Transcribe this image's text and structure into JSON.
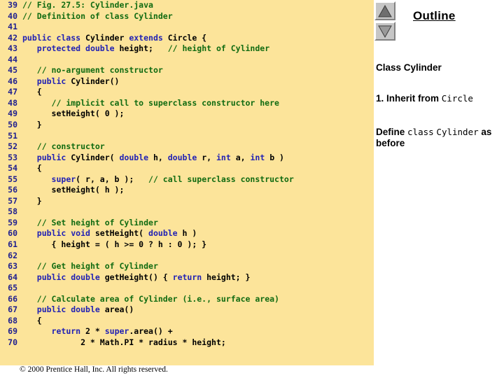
{
  "colors": {
    "code_background": "#fce49a",
    "keyword": "#2222b4",
    "comment": "#116b11",
    "plain_code": "#000000",
    "line_number": "#1f1f8f",
    "page_background": "#ffffff",
    "button_face": "#c6c6c6"
  },
  "code": {
    "lines": [
      {
        "no": "39",
        "segments": [
          {
            "t": "",
            "c": "plain"
          },
          {
            "t": "// Fig. 27.5: Cylinder.java",
            "c": "cmt"
          }
        ]
      },
      {
        "no": "40",
        "segments": [
          {
            "t": "// Definition of class Cylinder",
            "c": "cmt"
          }
        ]
      },
      {
        "no": "41",
        "segments": [
          {
            "t": "",
            "c": "plain"
          }
        ]
      },
      {
        "no": "42",
        "segments": [
          {
            "t": "public class ",
            "c": "kw"
          },
          {
            "t": "Cylinder ",
            "c": "plain"
          },
          {
            "t": "extends ",
            "c": "kw"
          },
          {
            "t": "Circle {",
            "c": "plain"
          }
        ]
      },
      {
        "no": "43",
        "segments": [
          {
            "t": "   ",
            "c": "plain"
          },
          {
            "t": "protected double ",
            "c": "kw"
          },
          {
            "t": "height;   ",
            "c": "plain"
          },
          {
            "t": "// height of Cylinder",
            "c": "cmt"
          }
        ]
      },
      {
        "no": "44",
        "segments": [
          {
            "t": "",
            "c": "plain"
          }
        ]
      },
      {
        "no": "45",
        "segments": [
          {
            "t": "   ",
            "c": "plain"
          },
          {
            "t": "// no-argument constructor",
            "c": "cmt"
          }
        ]
      },
      {
        "no": "46",
        "segments": [
          {
            "t": "   ",
            "c": "plain"
          },
          {
            "t": "public ",
            "c": "kw"
          },
          {
            "t": "Cylinder()",
            "c": "plain"
          }
        ]
      },
      {
        "no": "47",
        "segments": [
          {
            "t": "   {",
            "c": "plain"
          }
        ]
      },
      {
        "no": "48",
        "segments": [
          {
            "t": "      ",
            "c": "plain"
          },
          {
            "t": "// implicit call to superclass constructor here",
            "c": "cmt"
          }
        ]
      },
      {
        "no": "49",
        "segments": [
          {
            "t": "      setHeight( 0 );",
            "c": "plain"
          }
        ]
      },
      {
        "no": "50",
        "segments": [
          {
            "t": "   }",
            "c": "plain"
          }
        ]
      },
      {
        "no": "51",
        "segments": [
          {
            "t": "",
            "c": "plain"
          }
        ]
      },
      {
        "no": "52",
        "segments": [
          {
            "t": "   ",
            "c": "plain"
          },
          {
            "t": "// constructor",
            "c": "cmt"
          }
        ]
      },
      {
        "no": "53",
        "segments": [
          {
            "t": "   ",
            "c": "plain"
          },
          {
            "t": "public ",
            "c": "kw"
          },
          {
            "t": "Cylinder( ",
            "c": "plain"
          },
          {
            "t": "double ",
            "c": "kw"
          },
          {
            "t": "h, ",
            "c": "plain"
          },
          {
            "t": "double ",
            "c": "kw"
          },
          {
            "t": "r, ",
            "c": "plain"
          },
          {
            "t": "int ",
            "c": "kw"
          },
          {
            "t": "a, ",
            "c": "plain"
          },
          {
            "t": "int ",
            "c": "kw"
          },
          {
            "t": "b )",
            "c": "plain"
          }
        ]
      },
      {
        "no": "54",
        "segments": [
          {
            "t": "   {",
            "c": "plain"
          }
        ]
      },
      {
        "no": "55",
        "segments": [
          {
            "t": "      ",
            "c": "plain"
          },
          {
            "t": "super",
            "c": "kw"
          },
          {
            "t": "( r, a, b );   ",
            "c": "plain"
          },
          {
            "t": "// call superclass constructor",
            "c": "cmt"
          }
        ]
      },
      {
        "no": "56",
        "segments": [
          {
            "t": "      setHeight( h );",
            "c": "plain"
          }
        ]
      },
      {
        "no": "57",
        "segments": [
          {
            "t": "   }",
            "c": "plain"
          }
        ]
      },
      {
        "no": "58",
        "segments": [
          {
            "t": "",
            "c": "plain"
          }
        ]
      },
      {
        "no": "59",
        "segments": [
          {
            "t": "   ",
            "c": "plain"
          },
          {
            "t": "// Set height of Cylinder",
            "c": "cmt"
          }
        ]
      },
      {
        "no": "60",
        "segments": [
          {
            "t": "   ",
            "c": "plain"
          },
          {
            "t": "public void ",
            "c": "kw"
          },
          {
            "t": "setHeight( ",
            "c": "plain"
          },
          {
            "t": "double ",
            "c": "kw"
          },
          {
            "t": "h )",
            "c": "plain"
          }
        ]
      },
      {
        "no": "61",
        "segments": [
          {
            "t": "      { height = ( h >= 0 ? h : 0 ); }",
            "c": "plain"
          }
        ]
      },
      {
        "no": "62",
        "segments": [
          {
            "t": "",
            "c": "plain"
          }
        ]
      },
      {
        "no": "63",
        "segments": [
          {
            "t": "   ",
            "c": "plain"
          },
          {
            "t": "// Get height of Cylinder",
            "c": "cmt"
          }
        ]
      },
      {
        "no": "64",
        "segments": [
          {
            "t": "   ",
            "c": "plain"
          },
          {
            "t": "public double ",
            "c": "kw"
          },
          {
            "t": "getHeight() { ",
            "c": "plain"
          },
          {
            "t": "return ",
            "c": "kw"
          },
          {
            "t": "height; }",
            "c": "plain"
          }
        ]
      },
      {
        "no": "65",
        "segments": [
          {
            "t": "",
            "c": "plain"
          }
        ]
      },
      {
        "no": "66",
        "segments": [
          {
            "t": "   ",
            "c": "plain"
          },
          {
            "t": "// Calculate area of Cylinder (i.e., surface area)",
            "c": "cmt"
          }
        ]
      },
      {
        "no": "67",
        "segments": [
          {
            "t": "   ",
            "c": "plain"
          },
          {
            "t": "public double ",
            "c": "kw"
          },
          {
            "t": "area()",
            "c": "plain"
          }
        ]
      },
      {
        "no": "68",
        "segments": [
          {
            "t": "   {",
            "c": "plain"
          }
        ]
      },
      {
        "no": "69",
        "segments": [
          {
            "t": "      ",
            "c": "plain"
          },
          {
            "t": "return ",
            "c": "kw"
          },
          {
            "t": "2 * ",
            "c": "plain"
          },
          {
            "t": "super",
            "c": "kw"
          },
          {
            "t": ".area() +",
            "c": "plain"
          }
        ]
      },
      {
        "no": "70",
        "segments": [
          {
            "t": "            2 * Math.PI * radius * height;",
            "c": "plain"
          }
        ]
      }
    ]
  },
  "footer": {
    "copyright": "© 2000 Prentice Hall, Inc.  All rights reserved."
  },
  "outline": {
    "title": "Outline",
    "scroll_up_label": "scroll-up",
    "scroll_down_label": "scroll-down",
    "items": [
      {
        "id": "class-cylinder",
        "parts": [
          {
            "t": "Class Cylinder",
            "mono": false
          }
        ]
      },
      {
        "id": "inherit-from-circle",
        "parts": [
          {
            "t": "1. Inherit from ",
            "mono": false
          },
          {
            "t": "Circle",
            "mono": true
          }
        ]
      },
      {
        "id": "define-class-cylinder",
        "parts": [
          {
            "t": "Define ",
            "mono": false
          },
          {
            "t": "class",
            "mono": true
          },
          {
            "t": " ",
            "mono": false
          },
          {
            "t": "Cylinder",
            "mono": true
          },
          {
            "t": " as before",
            "mono": false
          }
        ]
      }
    ]
  }
}
